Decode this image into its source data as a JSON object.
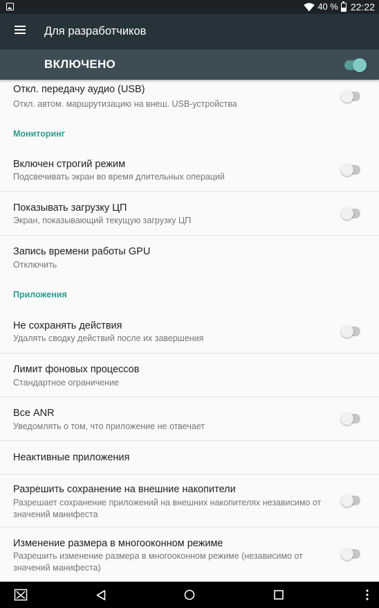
{
  "status_bar": {
    "battery_percent": "40 %",
    "time": "22:22"
  },
  "toolbar": {
    "title": "Для разработчиков"
  },
  "master_switch": {
    "label": "ВКЛЮЧЕНО",
    "enabled": true,
    "accent_color": "#80cbc4"
  },
  "colors": {
    "toolbar_bg": "#27333a",
    "switch_bar_bg": "#3d4c55",
    "category_text": "#2a9c8f"
  },
  "items": {
    "usb_audio": {
      "title": "Откл. передачу аудио (USB)",
      "summary": "Откл. автом. маршрутизацию на внеш. USB-устройства",
      "checked": false
    },
    "monitoring_header": "Мониторинг",
    "strict_mode": {
      "title": "Включен строгий режим",
      "summary": "Подсвечивать экран во время длительных операций",
      "checked": false
    },
    "cpu_usage": {
      "title": "Показывать загрузку ЦП",
      "summary": "Экран, показывающий текущую загрузку ЦП",
      "checked": false
    },
    "gpu_rendering": {
      "title": "Запись времени работы GPU",
      "summary": "Отключить"
    },
    "apps_header": "Приложения",
    "dont_keep_activities": {
      "title": "Не сохранять действия",
      "summary": "Удалять сводку действий после их завершения",
      "checked": false
    },
    "bg_process_limit": {
      "title": "Лимит фоновых процессов",
      "summary": "Стандартное ограничение"
    },
    "all_anrs": {
      "title": "Все ANR",
      "summary": "Уведомлять о том, что приложение не отвечает",
      "checked": false
    },
    "inactive_apps": {
      "title": "Неактивные приложения"
    },
    "force_external": {
      "title": "Разрешить сохранение на внешние накопители",
      "summary": "Разрешает сохранение приложений на внешних накопителях независимо от значений манифеста",
      "checked": false
    },
    "force_resizable": {
      "title": "Изменение размера в многооконном режиме",
      "summary": "Разрешить изменение размера в многооконном режиме (независимо от значений манифеста)",
      "checked": false
    }
  },
  "nav_bar": {
    "icons": [
      "screenshot-icon",
      "back-icon",
      "home-icon",
      "recents-icon",
      "more-vert-icon"
    ]
  }
}
